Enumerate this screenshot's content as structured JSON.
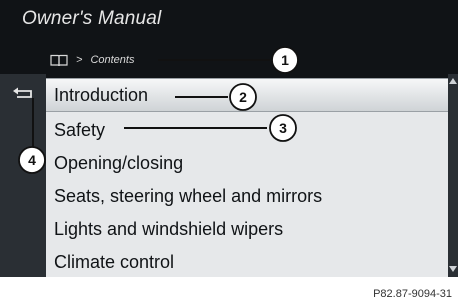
{
  "header": {
    "title": "Owner's Manual"
  },
  "breadcrumb": {
    "icon": "book-icon",
    "separator": ">",
    "current": "Contents"
  },
  "sidebar": {
    "back_icon": "back-arrow-icon"
  },
  "menu": {
    "items": [
      {
        "label": "Introduction",
        "selected": true
      },
      {
        "label": "Safety",
        "selected": false
      },
      {
        "label": "Opening/closing",
        "selected": false
      },
      {
        "label": "Seats, steering wheel and mirrors",
        "selected": false
      },
      {
        "label": "Lights and windshield wipers",
        "selected": false
      },
      {
        "label": "Climate control",
        "selected": false
      }
    ]
  },
  "callouts": [
    "1",
    "2",
    "3",
    "4"
  ],
  "figure_ref": "P82.87-9094-31",
  "colors": {
    "screen_bg": "#101316",
    "menu_bg": "#e6e8ea",
    "sidebar_bg": "#2a2f34"
  }
}
